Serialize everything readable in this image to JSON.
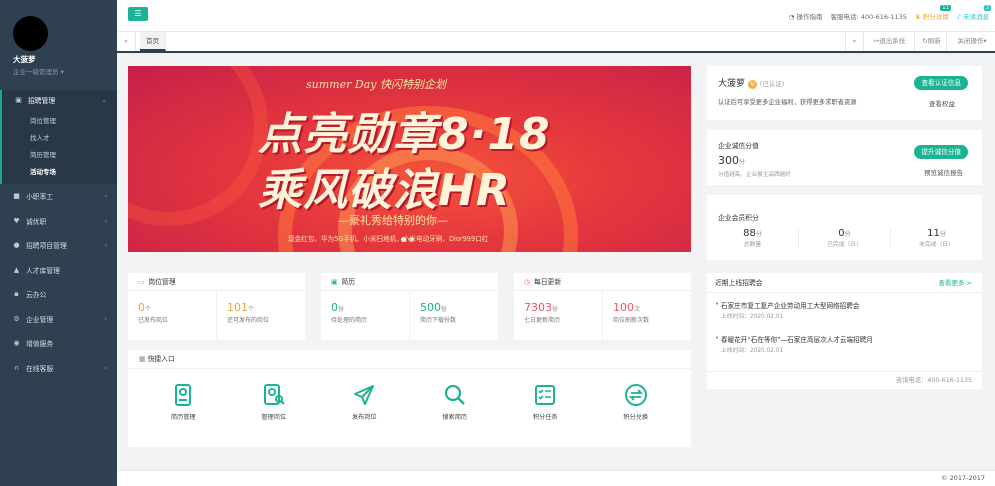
{
  "colors": {
    "sidebar_bg": "#2f4050",
    "accent": "#1ab394",
    "orange": "#e7a73a",
    "red": "#ed5565"
  },
  "sidebar": {
    "user_name": "大菠萝",
    "user_role": "企业一级管理员",
    "menu": [
      {
        "label": "招聘管理",
        "icon": "briefcase-icon"
      },
      {
        "label": "小职率工",
        "icon": "book-icon"
      },
      {
        "label": "诚优职",
        "icon": "heart-icon"
      },
      {
        "label": "招聘项目管理",
        "icon": "users-icon"
      },
      {
        "label": "人才库管理",
        "icon": "graduation-icon"
      },
      {
        "label": "云办公",
        "icon": "suitcase-icon"
      },
      {
        "label": "企业管理",
        "icon": "gear-icon"
      },
      {
        "label": "增值服务",
        "icon": "globe-icon"
      },
      {
        "label": "在线客服",
        "icon": "headset-icon"
      }
    ],
    "submenu": [
      "岗位管理",
      "找人才",
      "简历管理",
      "活动专场"
    ]
  },
  "topbar": {
    "guide": "操作指南",
    "hotline_label": "客服电话:",
    "hotline": "400-616-1135",
    "points_label": "积分详情",
    "points_badge": "11",
    "messages_label": "未读消息",
    "messages_badge": "3"
  },
  "tabs": {
    "home": "首页",
    "exit": "退出系统",
    "refresh": "刷新",
    "close_ops": "关闭操作"
  },
  "banner": {
    "top": "summer Day 快闪特别企划",
    "line1": "点亮勋章8·18",
    "line2": "乘风破浪HR",
    "sub": "—豪礼秀给特别的你—",
    "prize": "现金红包、华为5G手机、小米扫地机、小米电动牙刷、Dior999口红"
  },
  "cards": {
    "jobs": {
      "title": "岗位管理",
      "a_val": "0",
      "a_unit": "个",
      "a_lbl": "已发布岗位",
      "b_val": "101",
      "b_unit": "个",
      "b_lbl": "还可发布的岗位"
    },
    "resume": {
      "title": "简历",
      "a_val": "0",
      "a_unit": "份",
      "a_lbl": "待处理的简历",
      "b_val": "500",
      "b_unit": "份",
      "b_lbl": "简历下载份数"
    },
    "daily": {
      "title": "每日更新",
      "a_val": "7303",
      "a_unit": "份",
      "a_lbl": "七日更新简历",
      "b_val": "100",
      "b_unit": "次",
      "b_lbl": "岗位刷新次数"
    }
  },
  "quick": {
    "title": "快捷入口",
    "items": [
      "简历管理",
      "管理岗位",
      "发布岗位",
      "搜索简历",
      "积分任务",
      "积分兑换"
    ]
  },
  "company": {
    "name": "大菠萝",
    "verified": "(已认证)",
    "desc": "认证后可享受更多企业福利，获得更多求职者资源",
    "btn": "查看认证信息",
    "link": "查看权益"
  },
  "credit": {
    "title": "企业诚信分值",
    "score": "300",
    "unit": "分",
    "note": "分值越高，企业展主品牌越好",
    "btn": "提升诚信分值",
    "link": "预览诚信报告"
  },
  "member": {
    "title": "企业会员积分",
    "items": [
      {
        "val": "88",
        "unit": "分",
        "lbl": "总数量"
      },
      {
        "val": "0",
        "unit": "分",
        "lbl": "已完成（日）"
      },
      {
        "val": "11",
        "unit": "分",
        "lbl": "未完成（日）"
      }
    ]
  },
  "fairs": {
    "title": "近期上线招聘会",
    "more": "查看更多 >",
    "items": [
      {
        "title": "石家庄市复工复产企业劳动用工大型网络招聘会",
        "date": "上线时间：2020.02.01"
      },
      {
        "title": "春暖花开“石在等你”—石家庄高层次人才云端招聘月",
        "date": "上线时间：2020.02.01"
      }
    ],
    "hotline": "咨询电话：400-616-1135"
  },
  "footer": "© 2017-2017"
}
